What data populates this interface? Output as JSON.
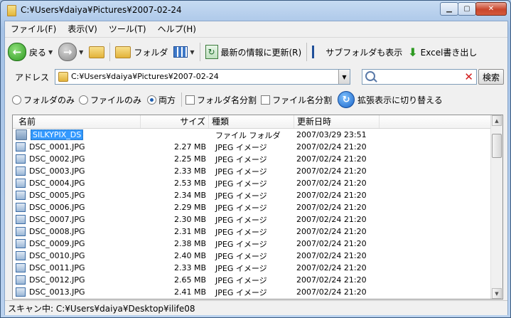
{
  "window": {
    "title": "C:¥Users¥daiya¥Pictures¥2007-02-24"
  },
  "menu": [
    "ファイル(F)",
    "表示(V)",
    "ツール(T)",
    "ヘルプ(H)"
  ],
  "toolbar": {
    "back_label": "戻る",
    "folder_label": "フォルダ",
    "refresh_label": "最新の情報に更新(R)",
    "subfolder_label": "サブフォルダも表示",
    "excel_label": "Excel書き出し"
  },
  "address": {
    "label": "アドレス",
    "value": "C:¥Users¥daiya¥Pictures¥2007-02-24"
  },
  "search": {
    "button_label": "検索",
    "value": ""
  },
  "options": {
    "radio_folder_only": "フォルダのみ",
    "radio_file_only": "ファイルのみ",
    "radio_both": "両方",
    "selected": "both",
    "check_folder_split": "フォルダ名分割",
    "check_file_split": "ファイル名分割",
    "expand_label": "拡張表示に切り替える"
  },
  "list": {
    "columns": [
      "名前",
      "サイズ",
      "種類",
      "更新日時"
    ],
    "rows": [
      {
        "name": "SILKYPIX_DS",
        "size": "",
        "type": "ファイル フォルダ",
        "date": "2007/03/29 23:51",
        "kind": "folder",
        "selected": true
      },
      {
        "name": "DSC_0001.JPG",
        "size": "2.27 MB",
        "type": "JPEG イメージ",
        "date": "2007/02/24 21:20",
        "kind": "image"
      },
      {
        "name": "DSC_0002.JPG",
        "size": "2.25 MB",
        "type": "JPEG イメージ",
        "date": "2007/02/24 21:20",
        "kind": "image"
      },
      {
        "name": "DSC_0003.JPG",
        "size": "2.33 MB",
        "type": "JPEG イメージ",
        "date": "2007/02/24 21:20",
        "kind": "image"
      },
      {
        "name": "DSC_0004.JPG",
        "size": "2.53 MB",
        "type": "JPEG イメージ",
        "date": "2007/02/24 21:20",
        "kind": "image"
      },
      {
        "name": "DSC_0005.JPG",
        "size": "2.34 MB",
        "type": "JPEG イメージ",
        "date": "2007/02/24 21:20",
        "kind": "image"
      },
      {
        "name": "DSC_0006.JPG",
        "size": "2.29 MB",
        "type": "JPEG イメージ",
        "date": "2007/02/24 21:20",
        "kind": "image"
      },
      {
        "name": "DSC_0007.JPG",
        "size": "2.30 MB",
        "type": "JPEG イメージ",
        "date": "2007/02/24 21:20",
        "kind": "image"
      },
      {
        "name": "DSC_0008.JPG",
        "size": "2.31 MB",
        "type": "JPEG イメージ",
        "date": "2007/02/24 21:20",
        "kind": "image"
      },
      {
        "name": "DSC_0009.JPG",
        "size": "2.38 MB",
        "type": "JPEG イメージ",
        "date": "2007/02/24 21:20",
        "kind": "image"
      },
      {
        "name": "DSC_0010.JPG",
        "size": "2.40 MB",
        "type": "JPEG イメージ",
        "date": "2007/02/24 21:20",
        "kind": "image"
      },
      {
        "name": "DSC_0011.JPG",
        "size": "2.33 MB",
        "type": "JPEG イメージ",
        "date": "2007/02/24 21:20",
        "kind": "image"
      },
      {
        "name": "DSC_0012.JPG",
        "size": "2.65 MB",
        "type": "JPEG イメージ",
        "date": "2007/02/24 21:20",
        "kind": "image"
      },
      {
        "name": "DSC_0013.JPG",
        "size": "2.41 MB",
        "type": "JPEG イメージ",
        "date": "2007/02/24 21:20",
        "kind": "image"
      }
    ]
  },
  "status": {
    "text": "スキャン中: C:¥Users¥daiya¥Desktop¥ilife08"
  }
}
